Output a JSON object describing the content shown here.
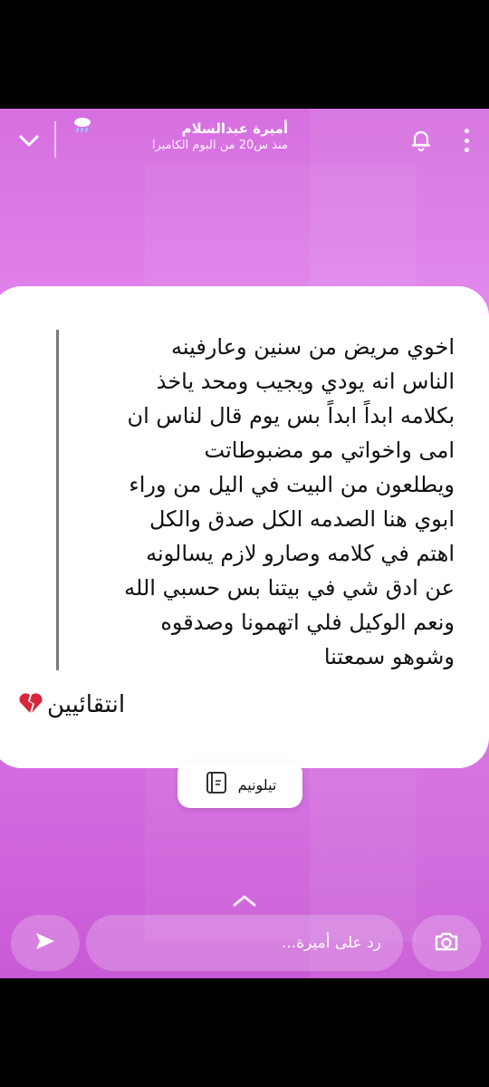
{
  "header": {
    "sender_name": "أميرة عبدالسلام",
    "sender_subtitle": "منذ س20 من البوم الكاميرا",
    "icons": [
      "chevron-down-icon",
      "cloud-rain-icon",
      "bell-icon",
      "more-vertical-icon"
    ]
  },
  "message": {
    "quoted_text": "اخوي مريض من سنين وعارفينه\nالناس انه يودي ويجيب ومحد ياخذ\nبكلامه ابداً ابداً بس يوم قال لناس ان\nامى واخواتي مو مضبوطاتت\nويطلعون من البيت في اليل من وراء\nابوي هنا الصدمه الكل صدق والكل\nاهتم في كلامه وصارو لازم يسالونه\nعن ادق شي في بيتنا بس حسبي الله\nونعم الوكيل فلي اتهمونا وصدقوه\nوشوهو سمعتنا",
    "caption": "انتقائيين",
    "caption_emoji": "broken-heart-icon"
  },
  "sticker_tag": {
    "label": "تيلونيم",
    "icon": "telonym-app-icon"
  },
  "bottom_bar": {
    "reply_placeholder": "رد على أميرة...",
    "icons": [
      "send-icon",
      "camera-icon",
      "chevron-up-icon"
    ]
  },
  "colors": {
    "background_top": "#e486ee",
    "background_bottom": "#c95ad6",
    "card": "#ffffff",
    "broken_heart": "#d7263d"
  }
}
